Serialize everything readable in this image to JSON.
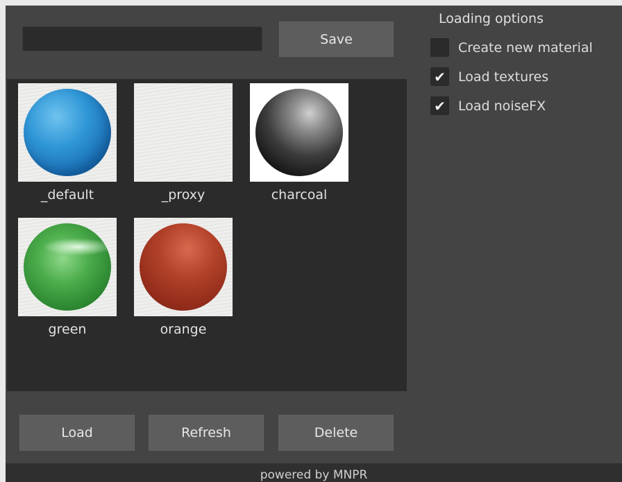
{
  "material_name_input": {
    "value": "",
    "placeholder": ""
  },
  "toolbar": {
    "save_label": "Save"
  },
  "materials": [
    {
      "name": "_default",
      "color": "#2f8fcf"
    },
    {
      "name": "_proxy",
      "color": "#eeeeec"
    },
    {
      "name": "charcoal",
      "color": "#2a2a2a"
    },
    {
      "name": "green",
      "color": "#3a9a3e"
    },
    {
      "name": "orange",
      "color": "#a83420"
    }
  ],
  "actions": {
    "load_label": "Load",
    "refresh_label": "Refresh",
    "delete_label": "Delete"
  },
  "loading_options": {
    "title": "Loading options",
    "items": [
      {
        "label": "Create new material",
        "checked": false
      },
      {
        "label": "Load textures",
        "checked": true
      },
      {
        "label": "Load noiseFX",
        "checked": true
      }
    ]
  },
  "footer": {
    "text": "powered by MNPR"
  },
  "colors": {
    "panel_bg": "#444444",
    "dark_bg": "#2b2b2b",
    "button_bg": "#5d5d5d"
  }
}
